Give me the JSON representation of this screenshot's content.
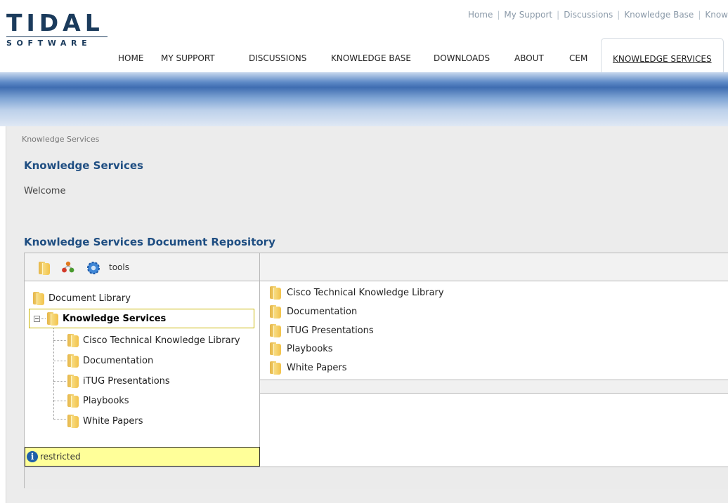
{
  "logo": {
    "word": "TIDAL",
    "sub": "SOFTWARE"
  },
  "util_links": [
    "Home",
    "My Support",
    "Discussions",
    "Knowledge Base",
    "Know"
  ],
  "nav": [
    "HOME",
    "MY SUPPORT",
    "DISCUSSIONS",
    "KNOWLEDGE BASE",
    "DOWNLOADS",
    "ABOUT",
    "CEM",
    "KNOWLEDGE SERVICES"
  ],
  "nav_active": "KNOWLEDGE SERVICES",
  "breadcrumb": "Knowledge Services",
  "page_title": "Knowledge Services",
  "welcome": "Welcome",
  "repo_title": "Knowledge Services Document Repository",
  "toolbar": {
    "icons": [
      "folder-icon",
      "groups-icon",
      "settings-icon"
    ],
    "tools_label": "tools"
  },
  "tree": {
    "root": "Document Library",
    "selected": "Knowledge Services",
    "children": [
      "Cisco Technical Knowledge Library",
      "Documentation",
      "iTUG Presentations",
      "Playbooks",
      "White Papers"
    ]
  },
  "status": {
    "icon": "info-icon",
    "text": "restricted"
  },
  "files": [
    "Cisco Technical Knowledge Library",
    "Documentation",
    "iTUG Presentations",
    "Playbooks",
    "White Papers"
  ],
  "colors": {
    "title_blue": "#1f4e82",
    "status_yellow": "#ffff99",
    "logo_navy": "#1b3b5c"
  }
}
